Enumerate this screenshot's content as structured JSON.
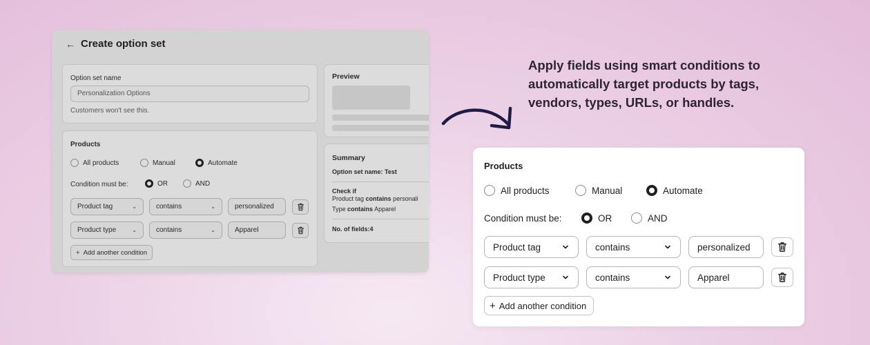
{
  "screenshot": {
    "title": "Create option set",
    "option_set": {
      "label": "Option set name",
      "value": "Personalization Options",
      "help": "Customers won't see this."
    },
    "products": {
      "title": "Products",
      "radios": [
        "All products",
        "Manual",
        "Automate"
      ],
      "selected_radio": "Automate",
      "condition_label": "Condition must be:",
      "condition_options": [
        "OR",
        "AND"
      ],
      "condition_selected": "OR",
      "rows": [
        {
          "field": "Product tag",
          "operator": "contains",
          "value": "personalized"
        },
        {
          "field": "Product type",
          "operator": "contains",
          "value": "Apparel"
        }
      ],
      "add_label": "Add another condition"
    },
    "preview": {
      "title": "Preview"
    },
    "summary": {
      "title": "Summary",
      "name_line": "Option set name: Test",
      "check_if": "Check if",
      "line1_field": "Product tag",
      "line1_op": "contains",
      "line1_value": "personali",
      "line2_field": "Type",
      "line2_op": "contains",
      "line2_value": "Apparel",
      "fields_line": "No. of fields:4"
    }
  },
  "caption": "Apply fields using smart conditions to automatically target products by tags, vendors, types, URLs, or handles.",
  "card": {
    "title": "Products",
    "radios": [
      "All products",
      "Manual",
      "Automate"
    ],
    "selected_radio": "Automate",
    "condition_label": "Condition must be:",
    "condition_options": [
      "OR",
      "AND"
    ],
    "condition_selected": "OR",
    "rows": [
      {
        "field": "Product tag",
        "operator": "contains",
        "value": "personalized"
      },
      {
        "field": "Product type",
        "operator": "contains",
        "value": "Apparel"
      }
    ],
    "add_label": "Add another condition"
  },
  "colors": {
    "background": "#ecd2e6",
    "arrow": "#1e1b47",
    "caption_text": "#2d2433",
    "radio_selected": "#1f1f1f"
  },
  "icons": {
    "back": "arrow-left-icon",
    "chevron": "chevron-down-icon",
    "trash": "trash-icon",
    "plus": "plus-icon",
    "curved_arrow": "curved-arrow-icon"
  }
}
